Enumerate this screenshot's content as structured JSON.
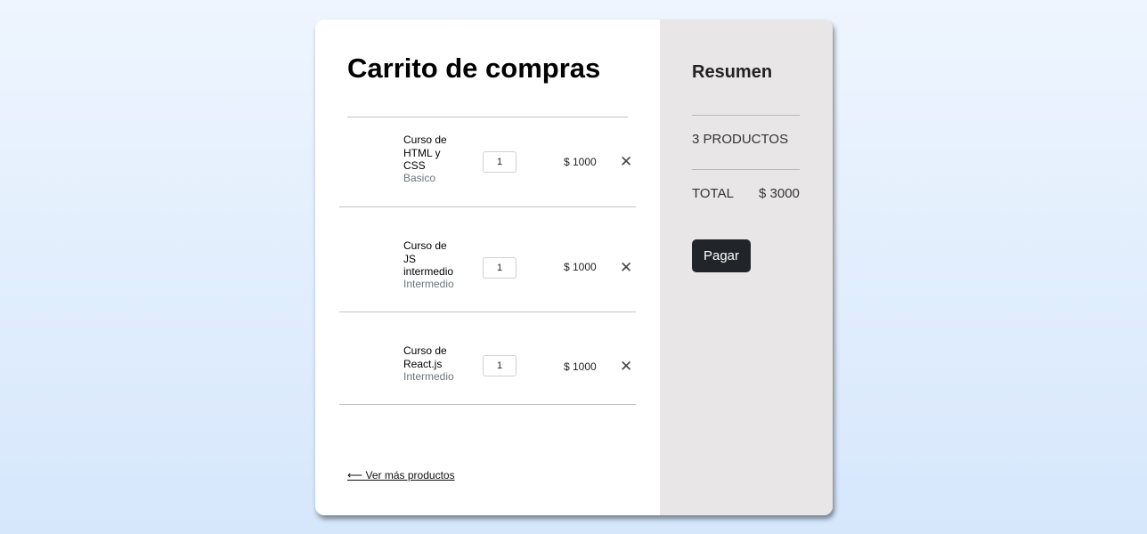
{
  "cart": {
    "title": "Carrito de compras",
    "items": [
      {
        "name": "Curso de HTML y CSS",
        "level": "Basico",
        "quantity": "1",
        "price": "$ 1000",
        "remove_glyph": "✕"
      },
      {
        "name": "Curso de JS intermedio",
        "level": "Intermedio",
        "quantity": "1",
        "price": "$ 1000",
        "remove_glyph": "✕"
      },
      {
        "name": "Curso de React.js",
        "level": "Intermedio",
        "quantity": "1",
        "price": "$ 1000",
        "remove_glyph": "✕"
      }
    ],
    "back_link": "⟵ Ver más productos"
  },
  "summary": {
    "title": "Resumen",
    "count": "3 PRODUCTOS",
    "total_label": "TOTAL",
    "total_value": "$ 3000",
    "pay_label": "Pagar"
  },
  "icons": {
    "remove": "close-icon"
  },
  "colors": {
    "pay_button": "#212529",
    "summary_bg": "#e9e6e7",
    "muted_text": "#6c757d"
  }
}
